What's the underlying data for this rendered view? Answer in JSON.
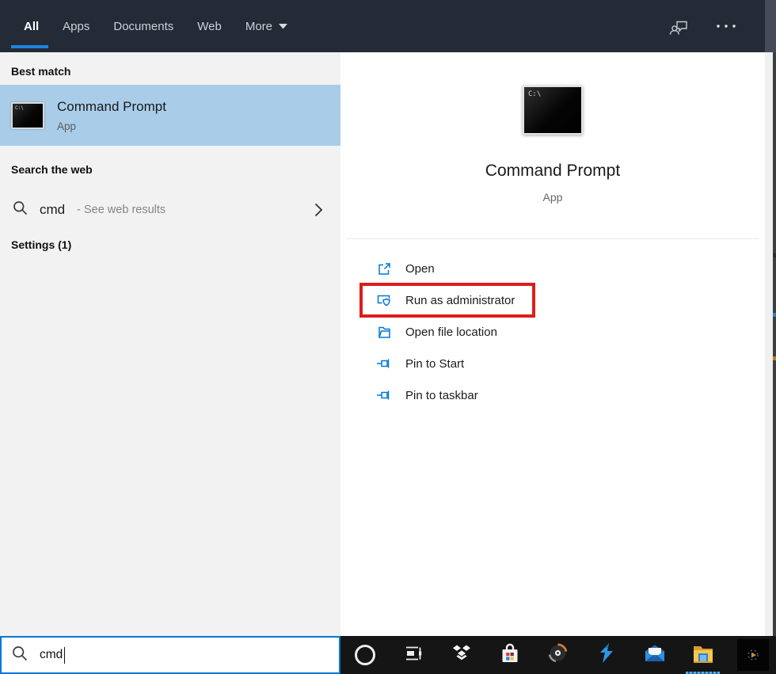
{
  "colors": {
    "topbar_bg": "#242b37",
    "accent_blue": "#0078d7",
    "tab_underline": "#1b85dd",
    "best_match_highlight": "#a9cde9",
    "left_panel_bg": "#f2f2f2",
    "red_box": "#df1c1c",
    "taskbar_bg": "#151515"
  },
  "topbar": {
    "tabs": [
      {
        "label": "All",
        "active": true
      },
      {
        "label": "Apps",
        "active": false
      },
      {
        "label": "Documents",
        "active": false
      },
      {
        "label": "Web",
        "active": false
      }
    ],
    "more": {
      "label": "More"
    },
    "icons": [
      {
        "name": "feedback-icon"
      },
      {
        "name": "ellipsis-icon"
      }
    ]
  },
  "left_panel": {
    "best_match_header": "Best match",
    "best_match": {
      "title": "Command Prompt",
      "subtitle": "App",
      "icon": "cmd-terminal-icon",
      "icon_text": "C:\\"
    },
    "search_web_header": "Search the web",
    "web_suggestion": {
      "query": "cmd",
      "suffix": "- See web results",
      "icon": "search-icon"
    },
    "settings_header": "Settings (1)"
  },
  "preview": {
    "icon": "cmd-terminal-icon",
    "icon_text": "C:\\",
    "title": "Command Prompt",
    "subtitle": "App",
    "actions": [
      {
        "label": "Open",
        "icon": "open-icon",
        "highlighted": false
      },
      {
        "label": "Run as administrator",
        "icon": "run-as-admin-shield-icon",
        "highlighted": true
      },
      {
        "label": "Open file location",
        "icon": "file-location-icon",
        "highlighted": false
      },
      {
        "label": "Pin to Start",
        "icon": "pin-icon",
        "highlighted": false
      },
      {
        "label": "Pin to taskbar",
        "icon": "pin-icon",
        "highlighted": false
      }
    ]
  },
  "taskbar": {
    "search": {
      "value": "cmd",
      "icon": "search-icon"
    },
    "buttons": [
      {
        "name": "cortana-button"
      },
      {
        "name": "task-view-button"
      },
      {
        "name": "dropbox-button"
      },
      {
        "name": "microsoft-store-button"
      },
      {
        "name": "media-disc-button"
      },
      {
        "name": "lightning-app-button"
      },
      {
        "name": "mail-button"
      },
      {
        "name": "file-explorer-button",
        "active": true
      },
      {
        "name": "pinned-dark-app-button"
      }
    ]
  }
}
